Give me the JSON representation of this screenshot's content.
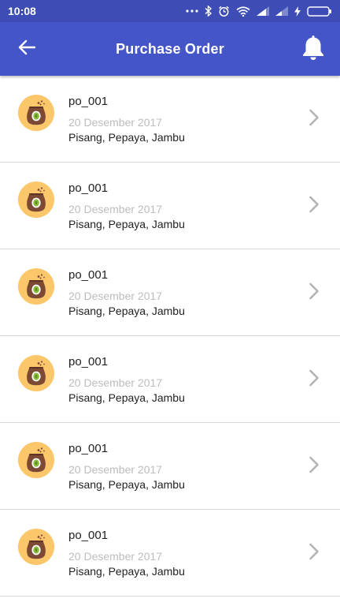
{
  "status_bar": {
    "time": "10:08",
    "icons": [
      "dots-icon",
      "bluetooth-icon",
      "alarm-icon",
      "wifi-icon",
      "signal-icon",
      "signal-icon",
      "charging-icon",
      "battery-icon"
    ]
  },
  "app_bar": {
    "title": "Purchase Order",
    "back_icon": "arrow-left-icon",
    "notification_icon": "bell-icon",
    "color": "#4456c7"
  },
  "orders": [
    {
      "id": "po_001",
      "date": "20 Desember 2017",
      "items": "Pisang, Pepaya, Jambu"
    },
    {
      "id": "po_001",
      "date": "20 Desember 2017",
      "items": "Pisang, Pepaya, Jambu"
    },
    {
      "id": "po_001",
      "date": "20 Desember 2017",
      "items": "Pisang, Pepaya, Jambu"
    },
    {
      "id": "po_001",
      "date": "20 Desember 2017",
      "items": "Pisang, Pepaya, Jambu"
    },
    {
      "id": "po_001",
      "date": "20 Desember 2017",
      "items": "Pisang, Pepaya, Jambu"
    },
    {
      "id": "po_001",
      "date": "20 Desember 2017",
      "items": "Pisang, Pepaya, Jambu"
    }
  ]
}
